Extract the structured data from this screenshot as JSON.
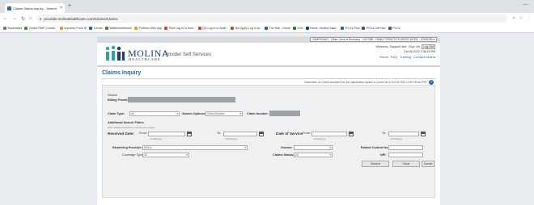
{
  "browser": {
    "tab_title": "Claims Status Inquiry - Search",
    "tab_close": "×",
    "new_tab": "+",
    "window_controls": "—",
    "url": "provider.molinahealthcare.com/Claims/Claims",
    "bookmarks": [
      {
        "label": "Bookmarks",
        "color": "#777777"
      },
      {
        "label": "Online RMP Course...",
        "color": "#4a8f3a"
      },
      {
        "label": "Imported From IE",
        "color": "#e0a21a"
      },
      {
        "label": "Cerner",
        "color": "#2a64a8"
      },
      {
        "label": "WellnessNetwork",
        "color": "#3a8f3a"
      },
      {
        "label": "Portfolio Web App",
        "color": "#e0a21a"
      },
      {
        "label": "Post Log In to Avai...",
        "color": "#d4472b"
      },
      {
        "label": "QD Log In to Avail...",
        "color": "#d4472b"
      },
      {
        "label": "Not Apply Log In to...",
        "color": "#d4472b"
      },
      {
        "label": "The Hub - Home",
        "color": "#2a64a8"
      },
      {
        "label": "ICW",
        "color": "#3a7a3a"
      },
      {
        "label": "Home | Molina Salut...",
        "color": "#1e3d74"
      },
      {
        "label": "PCCs Pool",
        "color": "#2a64a8"
      },
      {
        "label": "PCCs Left Nav",
        "color": "#555555"
      },
      {
        "label": "PCCs",
        "color": "#555555"
      }
    ]
  },
  "header": {
    "provider_select": "CAMPISANO - Other Lines of Business - 1417055 - FAMILY PRACTICE ASSOCIATES - 12345789 ▾",
    "brand": "MOLINA",
    "brand_sub": "HEALTHCARE",
    "portal_name": "Provider Self Services",
    "welcome": "Welcome, Support User",
    "signoff": "(Sign off)",
    "logout": "Log Out",
    "datetime": "Oct 06 2022 2:38:16 PM",
    "links": [
      "Home",
      "FAQ",
      "Training",
      "Contact Molina"
    ]
  },
  "title": "Claims Inquiry",
  "info_text": "Information on Claims accepted into the adjudication system is current as of Oct 05 2022 11:59 PM AM PST",
  "form": {
    "search_label": "Search",
    "billing_provider_label": "Billing Provider:",
    "claim_type_label": "Claim Type:",
    "claim_type_value": "All",
    "search_options_label": "Search Options:",
    "search_options_value": "Claim Number",
    "claim_number_label": "Claim Number:",
    "additional_label": "Additional Search Filters",
    "additional_hint": "Enter additional criteria to narrow your search",
    "received_date_label": "Received Date:",
    "from_label": "From:",
    "to_label": "To:",
    "date_hint": "mm/dd/yyyy",
    "date_of_service_label": "Date of Service",
    "rendering_provider_label": "Rendering Provider:",
    "rendering_provider_value": "Select",
    "gender_label": "Gender:",
    "patient_control_label": "Patient Control No:",
    "coverage_type_label": "Coverage Type:",
    "coverage_type_value": "All",
    "claims_status_label": "Claims Status:",
    "claims_status_value": "All",
    "npi_label": "NPI:",
    "search_button": "Search",
    "clear_button": "Clear",
    "cancel_button": "Cancel"
  },
  "colors": {
    "brand": "#1e3d74",
    "link": "#2a64a8",
    "logo_teal": "#2aa3a8",
    "logo_navy": "#1e3d74"
  }
}
